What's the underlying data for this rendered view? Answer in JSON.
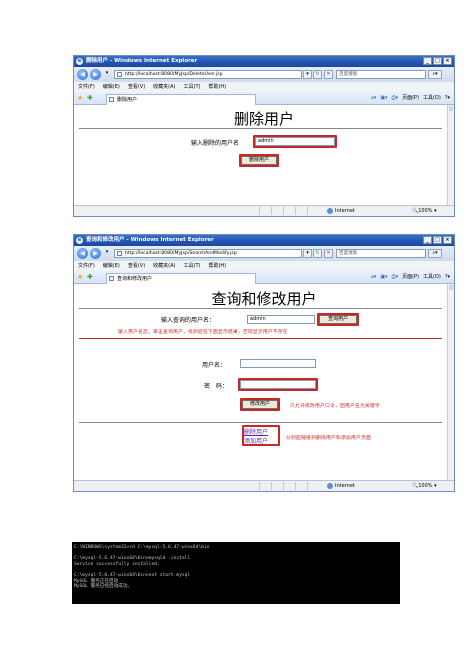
{
  "common": {
    "menu": [
      "文件(F)",
      "编辑(E)",
      "查看(V)",
      "收藏夹(A)",
      "工具(T)",
      "帮助(H)"
    ],
    "search_placeholder": "百度搜索",
    "tools_home": "页面(P)",
    "tools_tools": "工具(O)",
    "status_zone": "Internet",
    "status_zoom": "100%"
  },
  "window1": {
    "title": "删除用户 - Windows Internet Explorer",
    "url": "http://localhost:8080/MyJsp/DeleteUser.jsp",
    "tab": "删除用户",
    "heading": "删除用户",
    "username_label": "输入删除的用户名",
    "username_value": "admin",
    "delete_button": "删除用户"
  },
  "window2": {
    "title": "查询和修改用户 - Windows Internet Explorer",
    "url": "http://localhost:8080/MyJsp/SearchAndModify.jsp",
    "tab": "查询和修改用户",
    "heading": "查询和修改用户",
    "query_label": "输入查询的用户名：",
    "query_value": "admin",
    "query_button": "查询用户",
    "query_note": "输入用户名后，单击查询用户，找到后在下面显示结果，否则显示用户不存在",
    "username_label": "用户名：",
    "password_label": "密　码：",
    "modify_button": "修改用户",
    "modify_note": "只允许修改用户口令，因用户名为关键字",
    "link_delete": "删除用户",
    "link_add": "添加用户",
    "link_note": "分别超链接到删除用户和添加用户页面"
  },
  "console": {
    "lines": [
      "C:\\WINDOWS\\system32>cd C:\\mysql-5.6.47-winx64\\bin",
      "",
      "C:\\mysql-5.6.47-winx64\\bin>mysqld -install",
      "Service successfully installed.",
      "",
      "C:\\mysql-5.6.47-winx64\\bin>net start mysql",
      "MySQL 服务正在启动 .",
      "MySQL 服务已经启动成功。"
    ]
  }
}
